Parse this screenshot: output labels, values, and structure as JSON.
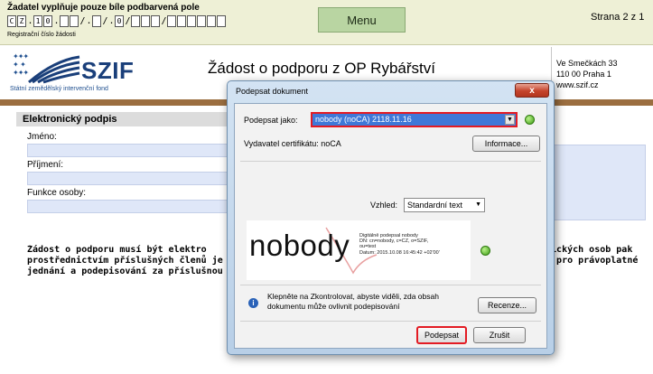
{
  "top": {
    "fill_note": "Žadatel vyplňuje pouze bíle podbarvená pole",
    "reg_chars": [
      "C",
      "Z",
      ".",
      "1",
      "0",
      ".",
      "",
      "",
      "/",
      ".",
      "",
      "/",
      ".",
      "0",
      "/",
      "",
      "",
      "",
      "/",
      "",
      "",
      "",
      "",
      "",
      ""
    ],
    "reg_label": "Registrační číslo žádosti",
    "menu_label": "Menu",
    "page_label": "Strana 2 z 1"
  },
  "header": {
    "logo_text": "SZIF",
    "logo_sub": "Státní zemědělský intervenční fond",
    "title": "Žádost o podporu z OP Rybářství",
    "address": [
      "Ve Smečkách 33",
      "110 00 Praha 1",
      "www.szif.cz"
    ]
  },
  "form": {
    "section_title": "Elektronický podpis",
    "fields": [
      "Jméno:",
      "Příjmení:",
      "Funkce osoby:"
    ],
    "paragraph_left": [
      "Žádost o podporu musí být elektro",
      "prostřednictvím příslušných členů je",
      "jednání a podepisování za příslušnou j"
    ],
    "paragraph_right": [
      "vnických osob pak",
      "em pro právoplatné",
      ""
    ]
  },
  "dialog": {
    "title": "Podepsat dokument",
    "close_label": "x",
    "sign_as_label": "Podepsat jako:",
    "sign_as_value": "nobody (noCA) 2118.11.16",
    "issuer_label": "Vydavatel certifikátu: noCA",
    "info_button": "Informace...",
    "appearance_label": "Vzhled:",
    "appearance_value": "Standardní text",
    "preview_name": "nobody",
    "preview_details": [
      "Digitálně podepsal nobody",
      "DN: cn=nobody, c=CZ, o=SZIF,",
      "ou=test",
      "Datum: 2015.10.08 16:45:42 +02'00'"
    ],
    "note": "Klepněte na Zkontrolovat, abyste viděli, zda obsah dokumentu může ovlivnit podepisování",
    "review_button": "Recenze...",
    "sign_button": "Podepsat",
    "cancel_button": "Zrušit"
  }
}
